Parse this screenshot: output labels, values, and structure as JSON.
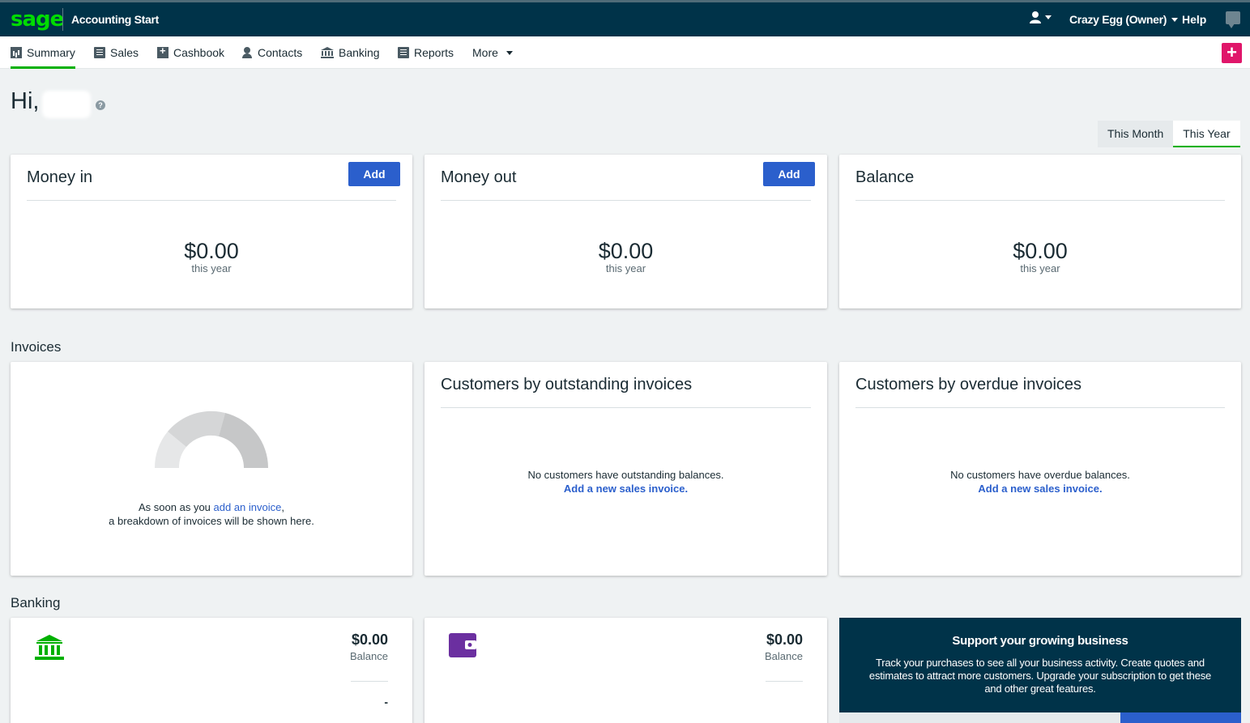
{
  "header": {
    "logo": "sage",
    "product": "Accounting Start",
    "user_name": "Crazy Egg (Owner)",
    "help": "Help"
  },
  "nav": [
    {
      "label": "Summary",
      "icon": "chart-icon"
    },
    {
      "label": "Sales",
      "icon": "document-icon"
    },
    {
      "label": "Cashbook",
      "icon": "cashbook-icon"
    },
    {
      "label": "Contacts",
      "icon": "person-icon"
    },
    {
      "label": "Banking",
      "icon": "bank-icon"
    },
    {
      "label": "Reports",
      "icon": "report-icon"
    },
    {
      "label": "More",
      "icon": "chevron-down-icon"
    }
  ],
  "greeting": "Hi,",
  "period": {
    "month": "This Month",
    "year": "This Year",
    "selected": "This Year"
  },
  "summary": [
    {
      "title": "Money in",
      "button": "Add",
      "amount": "$0.00",
      "sub": "this year"
    },
    {
      "title": "Money out",
      "button": "Add",
      "amount": "$0.00",
      "sub": "this year"
    },
    {
      "title": "Balance",
      "amount": "$0.00",
      "sub": "this year"
    }
  ],
  "invoices": {
    "section": "Invoices",
    "empty_prefix": "As soon as you ",
    "empty_link": "add an invoice",
    "empty_suffix": ",",
    "empty_line2": "a breakdown of invoices will be shown here.",
    "outstanding_title": "Customers by outstanding invoices",
    "outstanding_msg": "No customers have outstanding balances.",
    "outstanding_link": "Add a new sales invoice.",
    "overdue_title": "Customers by overdue invoices",
    "overdue_msg": "No customers have overdue balances.",
    "overdue_link": "Add a new sales invoice."
  },
  "banking": {
    "section": "Banking",
    "accounts": [
      {
        "amount": "$0.00",
        "label": "Balance",
        "dash": "-",
        "icon": "bank-icon",
        "icon_color": "#00b000"
      },
      {
        "amount": "$0.00",
        "label": "Balance",
        "icon": "wallet-icon",
        "icon_color": "#6b2fa0"
      }
    ],
    "promo_title": "Support your growing business",
    "promo_text": "Track your purchases to see all your business activity. Create quotes and estimates to attract more customers. Upgrade your subscription to get these and other great features."
  },
  "colors": {
    "topbar": "#003349",
    "accent_green": "#00b000",
    "button_blue": "#2b5fcc",
    "plus_pink": "#e0166a"
  }
}
